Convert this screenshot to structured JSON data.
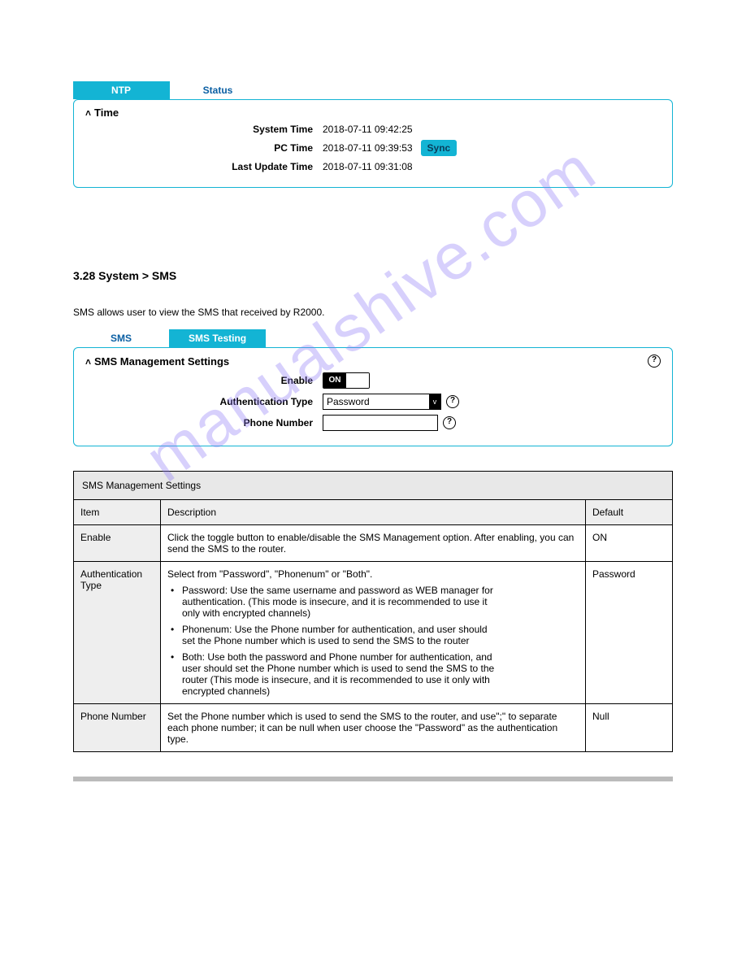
{
  "watermark": "manualshive.com",
  "time_panel": {
    "tabs": {
      "ntp": "NTP",
      "status": "Status"
    },
    "title": "Time",
    "rows": {
      "system_time_label": "System Time",
      "system_time_value": "2018-07-11 09:42:25",
      "pc_time_label": "PC Time",
      "pc_time_value": "2018-07-11 09:39:53",
      "sync_label": "Sync",
      "last_update_label": "Last Update Time",
      "last_update_value": "2018-07-11 09:31:08"
    }
  },
  "sms_heading": "3.28 System > SMS",
  "sms_intro": "SMS allows user to view the SMS that received by R2000.",
  "sms_panel": {
    "tabs": {
      "sms": "SMS",
      "sms_testing": "SMS Testing"
    },
    "title": "SMS Management Settings",
    "rows": {
      "enable_label": "Enable",
      "enable_value": "ON",
      "auth_type_label": "Authentication Type",
      "auth_type_value": "Password",
      "phone_label": "Phone Number"
    }
  },
  "table": {
    "main_header": "SMS Management Settings",
    "headers": {
      "item": "Item",
      "description": "Description",
      "default": "Default"
    },
    "rows": {
      "enable": {
        "item": "Enable",
        "desc": "Click the toggle button to enable/disable the SMS Management option. After enabling, you can send the SMS to the router.",
        "def": "ON"
      },
      "auth": {
        "item": "Authentication Type",
        "desc_intro": "Select from \"Password\", \"Phonenum\" or \"Both\".",
        "desc_password": "Password: Use the same username and password as WEB manager for",
        "desc_password2": "authentication. (This mode is insecure, and it is recommended to use it",
        "desc_password3": "only with encrypted channels)",
        "desc_phonenum": "Phonenum: Use the Phone number for authentication, and user should",
        "desc_phonenum2": "set the Phone number which is used to send the SMS to the router",
        "desc_both": "Both: Use both the password and Phone number for authentication, and",
        "desc_both2": "user should set the Phone number which is used to send the SMS to the",
        "desc_both3": "router (This mode is insecure, and it is recommended to use it only with",
        "desc_both4": "encrypted channels)",
        "def": "Password"
      },
      "phone": {
        "item": "Phone Number",
        "desc": "Set the Phone number which is used to send the SMS to the router, and use\";\" to separate each phone number; it can be null when user choose the \"Password\" as the authentication type.",
        "def": "Null"
      }
    }
  }
}
